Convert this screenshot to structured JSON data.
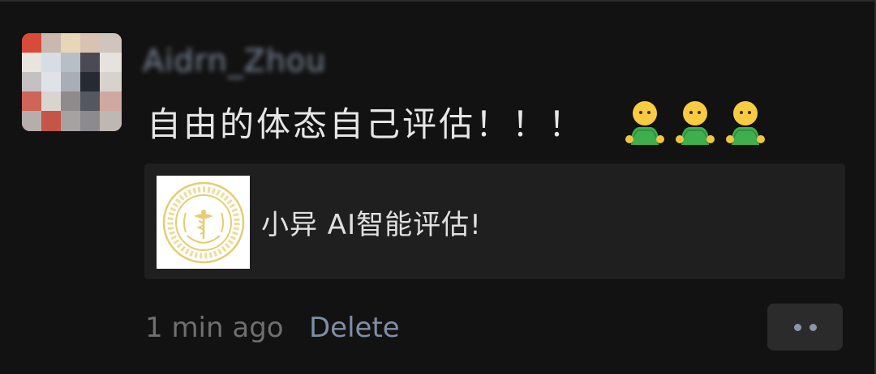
{
  "comment": {
    "username": "Aidrn_Zhou",
    "text": "自由的体态自己评估！！！",
    "emojis": [
      "person-emoji",
      "person-emoji",
      "person-emoji"
    ],
    "link_preview": {
      "title": "小异 AI智能评估!",
      "thumbnail_icon": "caduceus-emblem-logo"
    },
    "timestamp": "1 min ago",
    "delete_label": "Delete",
    "more_icon": "more-dots-icon"
  },
  "colors": {
    "background": "#121212",
    "card_background": "#1f1f1f",
    "username": "#7b8696",
    "post_text": "#e6e6e6",
    "timestamp": "#6f6f6f",
    "link_accent": "#7f8da6",
    "emblem_gold": "#e6cc72"
  }
}
